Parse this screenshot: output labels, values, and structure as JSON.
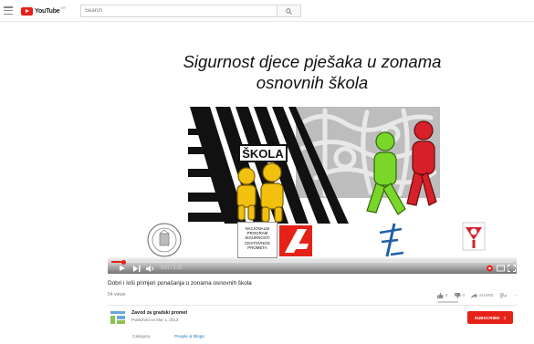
{
  "header": {
    "logo_text": "YouTube",
    "logo_country": "HR",
    "search_placeholder": "Search"
  },
  "slide": {
    "title": "Sigurnost djece pješaka u zonama\nosnovnih škola",
    "sign_text": "ŠKOLA",
    "npscp_logo_text": "NACIONALNI PROGRAM SIGURNOSTI CESTOVNOG PROMETA"
  },
  "player": {
    "time": "0:01 / 2:22",
    "progress_fraction": 0.03
  },
  "video": {
    "title": "Dobri i loši primjeri ponašanja u zonama osnovnih škola",
    "views": "54 views",
    "likes": "0",
    "dislikes": "0",
    "share_label": "SHARE",
    "more_label": "···",
    "like_fraction": 0
  },
  "owner": {
    "name": "Zavod za gradski promet",
    "published": "Published on Mar 1, 2013",
    "subscribe_label": "SUBSCRIBE",
    "subscriber_count": "3"
  },
  "meta": {
    "category_label": "Category",
    "category_value": "People & Blogs"
  },
  "colors": {
    "brand_red": "#e62117",
    "link_blue": "#167ac6",
    "figure_yellow": "#f2c00f",
    "figure_green": "#7bd62a",
    "figure_red": "#d8202a"
  }
}
